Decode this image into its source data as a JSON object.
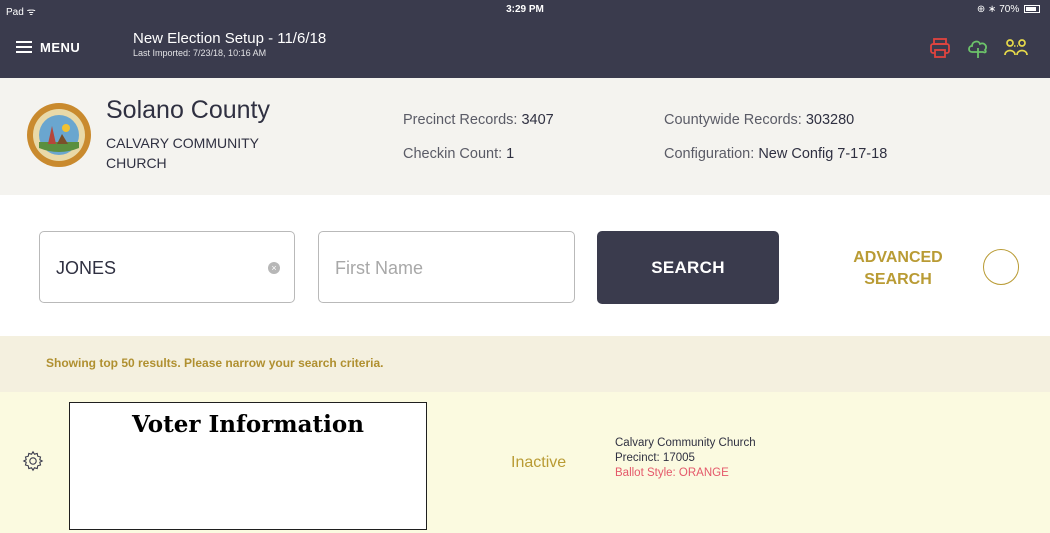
{
  "status_bar": {
    "device": "Pad",
    "time": "3:29 PM",
    "battery": "70%"
  },
  "nav": {
    "menu_label": "MENU",
    "election_title": "New Election Setup - 11/6/18",
    "last_imported": "Last Imported: 7/23/18, 10:16 AM",
    "icons": [
      "printer-icon",
      "cloud-tree-icon",
      "users-icon"
    ],
    "colors": {
      "bar": "#3a3b4d",
      "printer": "#e0443f",
      "cloud": "#6cc36a",
      "users": "#e6d94a"
    }
  },
  "header": {
    "county": "Solano County",
    "location": "CALVARY COMMUNITY CHURCH",
    "precinct_records_label": "Precinct Records:",
    "precinct_records_value": "3407",
    "checkin_count_label": "Checkin Count:",
    "checkin_count_value": "1",
    "countywide_records_label": "Countywide Records:",
    "countywide_records_value": "303280",
    "configuration_label": "Configuration:",
    "configuration_value": "New Config 7-17-18"
  },
  "search": {
    "last_name_value": "JONES",
    "first_name_placeholder": "First Name",
    "clear_symbol": "×",
    "search_button": "SEARCH",
    "advanced_line1": "ADVANCED",
    "advanced_line2": "SEARCH",
    "accent": "#b99b34"
  },
  "results": {
    "banner_text": "Showing top 50 results. Please narrow your search criteria.",
    "rows": [
      {
        "voter_info_label": "Voter Information",
        "status": "Inactive",
        "location": "Calvary Community Church",
        "precinct": "Precinct: 17005",
        "ballot_style": "Ballot Style: ORANGE"
      }
    ]
  }
}
